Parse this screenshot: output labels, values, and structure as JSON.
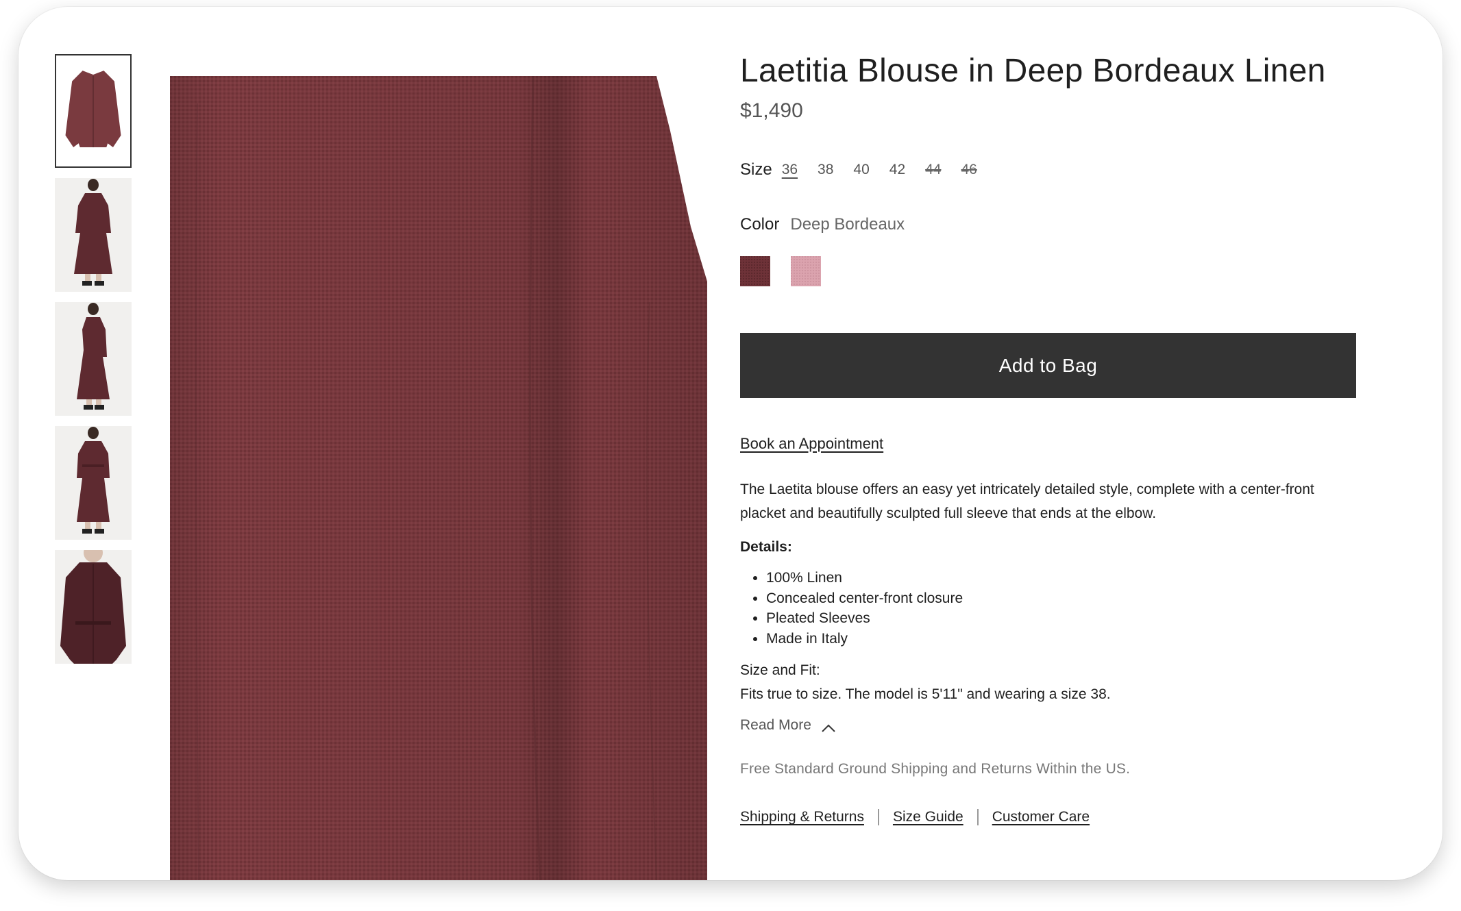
{
  "product": {
    "title": "Laetitia Blouse in Deep Bordeaux Linen",
    "price": "$1,490"
  },
  "size": {
    "label": "Size",
    "options": [
      {
        "label": "36",
        "state": "selected"
      },
      {
        "label": "38",
        "state": "available"
      },
      {
        "label": "40",
        "state": "available"
      },
      {
        "label": "42",
        "state": "available"
      },
      {
        "label": "44",
        "state": "unavailable"
      },
      {
        "label": "46",
        "state": "unavailable"
      }
    ]
  },
  "color": {
    "label": "Color",
    "value": "Deep Bordeaux",
    "swatches": [
      {
        "name": "Deep Bordeaux",
        "hex": "#6e3238"
      },
      {
        "name": "Pink",
        "hex": "#dba3ae"
      }
    ]
  },
  "actions": {
    "add_to_bag": "Add to Bag",
    "book_appointment": "Book an Appointment"
  },
  "description": {
    "text": "The Laetita blouse offers an easy yet intricately detailed style, complete with a center-front placket and beautifully sculpted full sleeve that ends at the elbow.",
    "details_heading": "Details:",
    "details": [
      "100% Linen",
      "Concealed center-front closure",
      "Pleated Sleeves",
      "Made in Italy"
    ],
    "size_fit_heading": "Size and Fit:",
    "size_fit_text": "Fits true to size. The model is 5'11\" and wearing a size 38.",
    "read_more": "Read More"
  },
  "shipping_note": "Free Standard Ground Shipping and Returns Within the US.",
  "footer_links": [
    "Shipping & Returns",
    "Size Guide",
    "Customer Care"
  ],
  "colors": {
    "fabric": "#7a3a3f",
    "button": "#333333"
  },
  "thumbnails": [
    {
      "icon": "blouse-flat-image"
    },
    {
      "icon": "model-front-image"
    },
    {
      "icon": "model-side-image"
    },
    {
      "icon": "model-front-belted-image"
    },
    {
      "icon": "model-closeup-image"
    }
  ]
}
